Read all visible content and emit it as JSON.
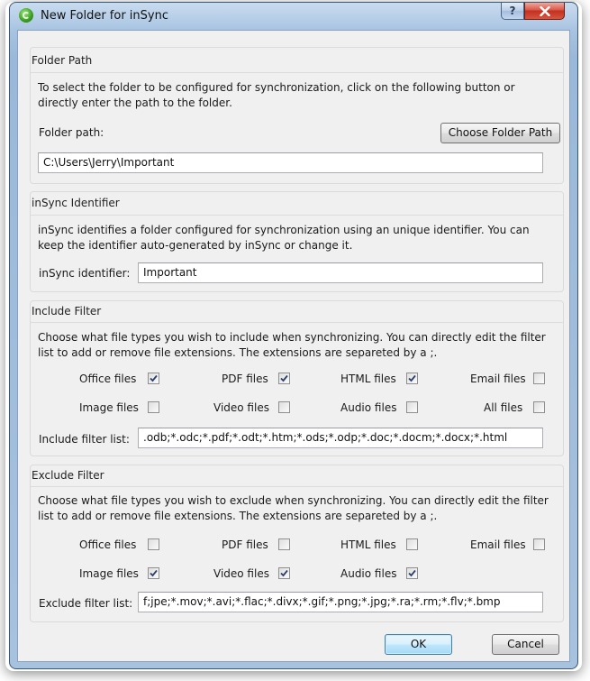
{
  "window": {
    "title": "New Folder for inSync",
    "help_label": "?",
    "close_label": "x"
  },
  "folder_path": {
    "group_title": "Folder Path",
    "description": "To select the folder to be configured for synchronization, click on the following button or directly enter the path to the folder.",
    "path_label": "Folder path:",
    "choose_button": "Choose Folder Path",
    "path_value": "C:\\Users\\Jerry\\Important"
  },
  "identifier": {
    "group_title": "inSync Identifier",
    "description": "inSync identifies a folder configured for synchronization using an unique identifier. You can keep the identifier auto-generated by inSync or change it.",
    "label": "inSync identifier:",
    "value": "Important"
  },
  "include_filter": {
    "group_title": "Include Filter",
    "description": "Choose what file types you wish to include when synchronizing. You can directly edit the filter list to add or remove file extensions. The extensions are separeted by a ;.",
    "options": [
      {
        "label": "Office files",
        "checked": true
      },
      {
        "label": "PDF files",
        "checked": true
      },
      {
        "label": "HTML files",
        "checked": true
      },
      {
        "label": "Email files",
        "checked": false
      },
      {
        "label": "Image files",
        "checked": false
      },
      {
        "label": "Video files",
        "checked": false
      },
      {
        "label": "Audio files",
        "checked": false
      },
      {
        "label": "All files",
        "checked": false
      }
    ],
    "list_label": "Include filter list:",
    "list_value": ".odb;*.odc;*.pdf;*.odt;*.htm;*.ods;*.odp;*.doc;*.docm;*.docx;*.html"
  },
  "exclude_filter": {
    "group_title": "Exclude Filter",
    "description": "Choose what file types you wish to exclude when synchronizing. You can directly edit the filter list to add or remove file extensions. The extensions are separeted by a ;.",
    "options": [
      {
        "label": "Office files",
        "checked": false
      },
      {
        "label": "PDF files",
        "checked": false
      },
      {
        "label": "HTML files",
        "checked": false
      },
      {
        "label": "Email files",
        "checked": false
      },
      {
        "label": "Image files",
        "checked": true
      },
      {
        "label": "Video files",
        "checked": true
      },
      {
        "label": "Audio files",
        "checked": true
      }
    ],
    "list_label": "Exclude filter list:",
    "list_value": "f;jpe;*.mov;*.avi;*.flac;*.divx;*.gif;*.png;*.jpg;*.ra;*.rm;*.flv;*.bmp"
  },
  "buttons": {
    "ok": "OK",
    "cancel": "Cancel"
  }
}
